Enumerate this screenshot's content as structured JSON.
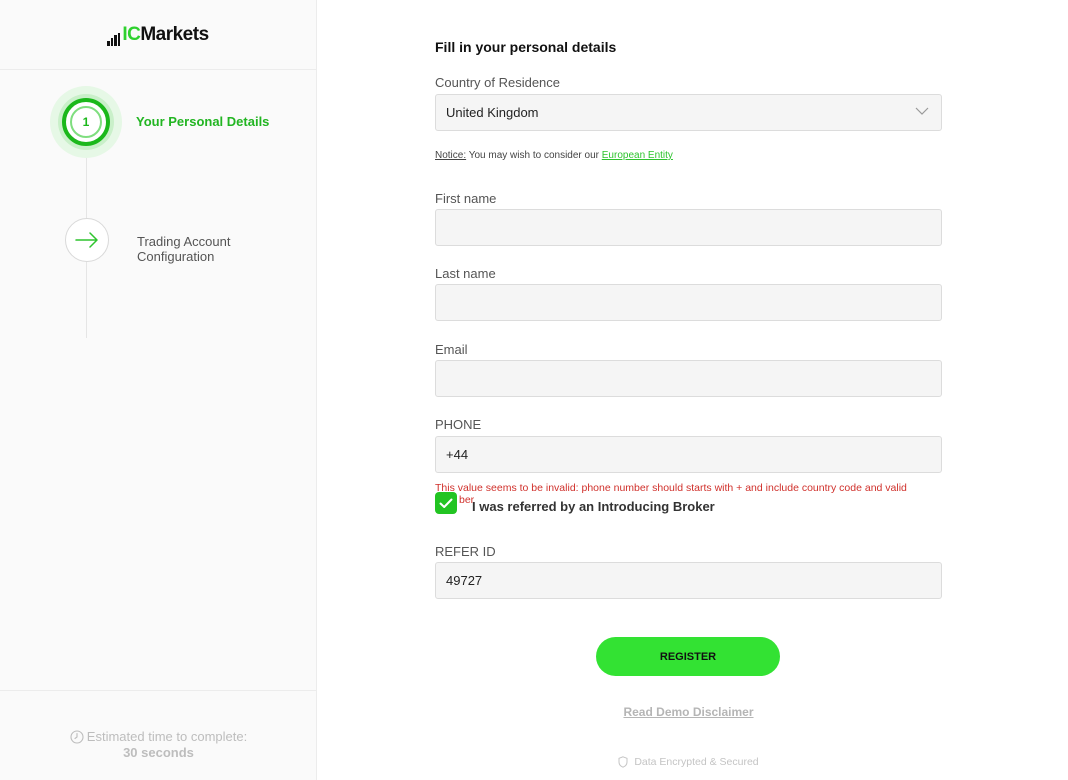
{
  "brand": {
    "logo_ic": "IC",
    "logo_markets": "Markets",
    "accent": "#2ed12e"
  },
  "steps": [
    {
      "number": "1",
      "label": "Your Personal Details",
      "state": "active"
    },
    {
      "label_line1": "Trading Account",
      "label_line2": "Configuration",
      "icon": "arrow-right-icon",
      "state": "pending"
    }
  ],
  "estimate": {
    "label": "Estimated time to complete:",
    "time": "30 seconds",
    "icon": "clock-icon"
  },
  "form": {
    "title": "Fill in your personal details",
    "country": {
      "label": "Country of Residence",
      "value": "United Kingdom",
      "icon": "chevron-down-icon"
    },
    "notice": {
      "prefix": "Notice:",
      "text": " You may wish to consider our ",
      "link": "European Entity"
    },
    "first_name": {
      "label": "First name",
      "value": ""
    },
    "last_name": {
      "label": "Last name",
      "value": ""
    },
    "email": {
      "label": "Email",
      "value": ""
    },
    "phone": {
      "label": "PHONE",
      "value": "+44",
      "error": "This value seems to be invalid: phone number should starts with + and include country code and valid",
      "error_tail": "ber"
    },
    "referred": {
      "checked": true,
      "label": "I was referred by an Introducing Broker"
    },
    "refer_id": {
      "label": "REFER ID",
      "value": "49727"
    },
    "register_label": "REGISTER",
    "disclaimer": "Read Demo Disclaimer",
    "secured": "Data Encrypted & Secured"
  }
}
